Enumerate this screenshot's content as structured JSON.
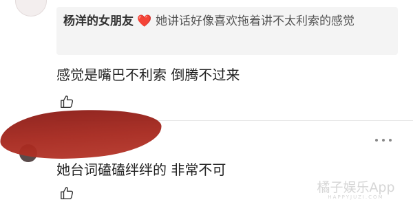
{
  "quoted_comment": {
    "author": "杨洋的女朋友",
    "emoji": "❤️",
    "text": "她讲话好像喜欢拖着讲不太利索的感觉"
  },
  "reply_1": {
    "text": "感觉是嘴巴不利索 倒腾不过来",
    "like_icon": "thumbs-up-icon"
  },
  "comment_2": {
    "text": "她台词磕磕绊绊的 非常不可",
    "like_icon": "thumbs-up-icon",
    "more_icon": "more-dots-icon"
  },
  "watermark": {
    "text": "橘子娱乐App",
    "sub": "HAPPYJUZI.COM"
  },
  "colors": {
    "redaction": "#a3241a",
    "heart": "#e0282e",
    "quote_bg": "#f4f4f4"
  }
}
